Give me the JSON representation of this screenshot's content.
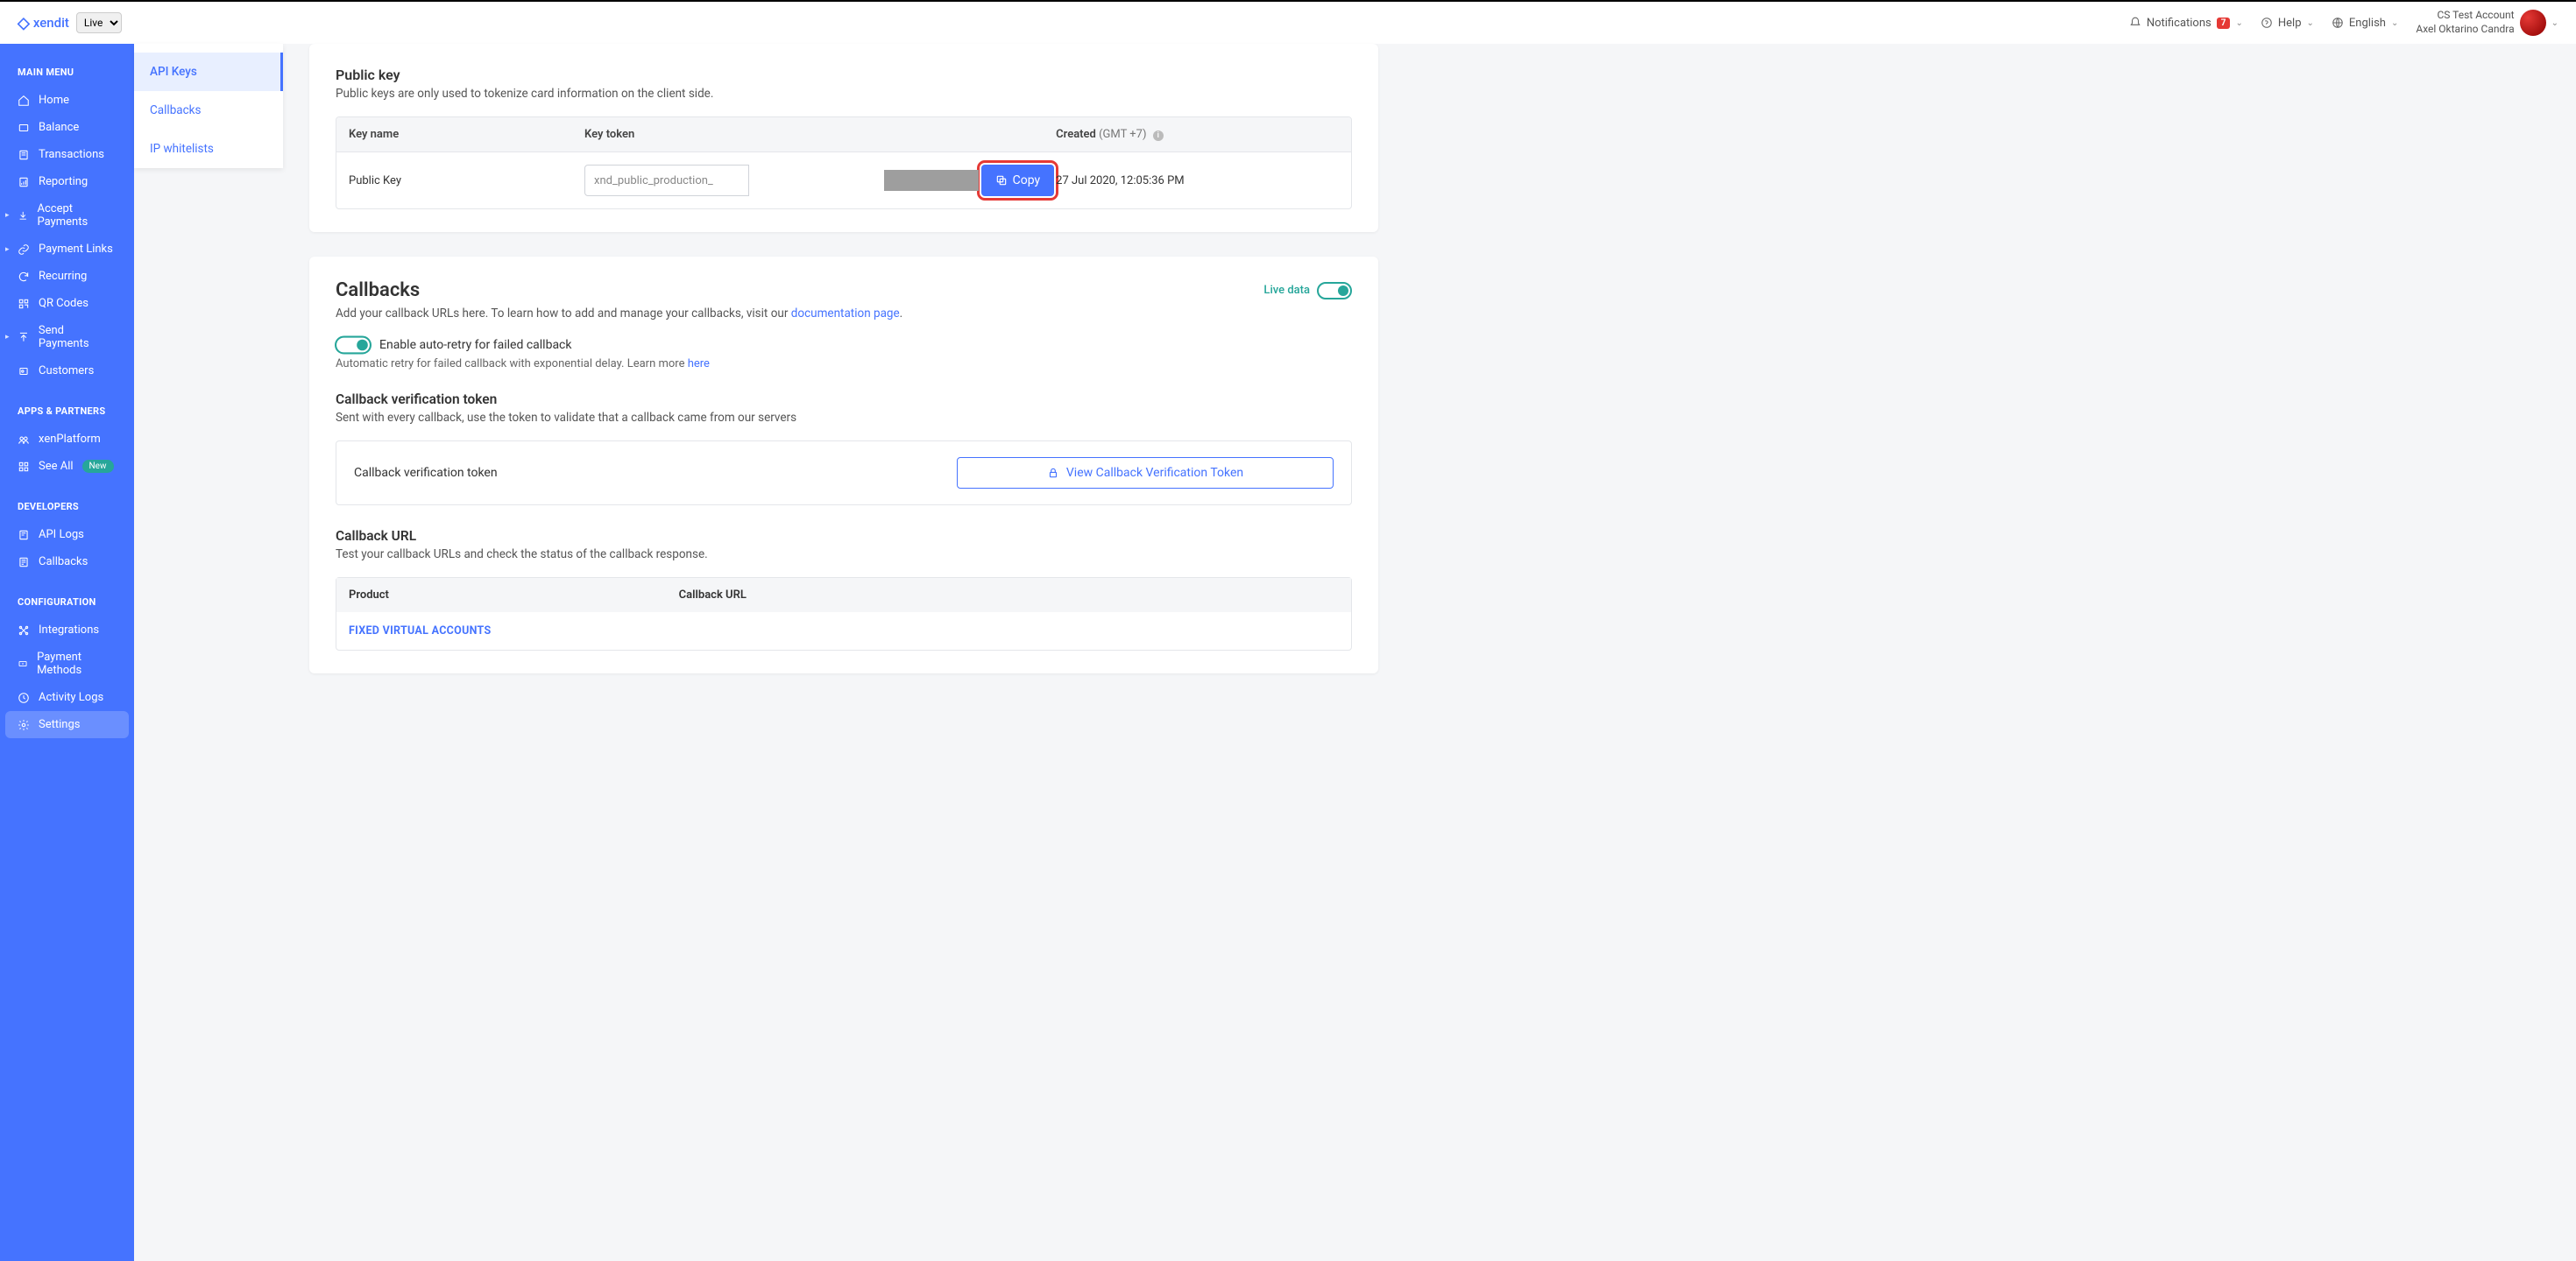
{
  "topbar": {
    "logo": "xendit",
    "env": "Live",
    "notifications_label": "Notifications",
    "notifications_count": "7",
    "help_label": "Help",
    "language_label": "English",
    "account_name": "CS Test Account",
    "user_name": "Axel Oktarino Candra"
  },
  "sidebar": {
    "section_main": "MAIN MENU",
    "items_main": [
      {
        "label": "Home"
      },
      {
        "label": "Balance"
      },
      {
        "label": "Transactions"
      },
      {
        "label": "Reporting"
      },
      {
        "label": "Accept Payments"
      },
      {
        "label": "Payment Links"
      },
      {
        "label": "Recurring"
      },
      {
        "label": "QR Codes"
      },
      {
        "label": "Send Payments"
      },
      {
        "label": "Customers"
      }
    ],
    "section_apps": "APPS & PARTNERS",
    "items_apps": [
      {
        "label": "xenPlatform"
      },
      {
        "label": "See All",
        "badge": "New"
      }
    ],
    "section_dev": "DEVELOPERS",
    "items_dev": [
      {
        "label": "API Logs"
      },
      {
        "label": "Callbacks"
      }
    ],
    "section_config": "CONFIGURATION",
    "items_config": [
      {
        "label": "Integrations"
      },
      {
        "label": "Payment Methods"
      },
      {
        "label": "Activity Logs"
      },
      {
        "label": "Settings"
      }
    ]
  },
  "subsidebar": {
    "items": [
      {
        "label": "API Keys"
      },
      {
        "label": "Callbacks"
      },
      {
        "label": "IP whitelists"
      }
    ]
  },
  "public_key": {
    "title": "Public key",
    "desc": "Public keys are only used to tokenize card information on the client side.",
    "col_name": "Key name",
    "col_token": "Key token",
    "col_created": "Created",
    "col_created_tz": "(GMT +7)",
    "row_name": "Public Key",
    "row_token": "xnd_public_production_",
    "copy_label": "Copy",
    "row_created": "27 Jul 2020, 12:05:36 PM"
  },
  "callbacks": {
    "title": "Callbacks",
    "live_data_label": "Live data",
    "intro_pre": "Add your callback URLs here. To learn how to add and manage your callbacks, visit our ",
    "intro_link": "documentation page",
    "intro_post": ".",
    "auto_retry_label": "Enable auto-retry for failed callback",
    "auto_retry_desc_pre": "Automatic retry for failed callback with exponential delay. Learn more ",
    "auto_retry_link": "here",
    "verif_title": "Callback verification token",
    "verif_desc": "Sent with every callback, use the token to validate that a callback came from our servers",
    "verif_row_label": "Callback verification token",
    "verif_button": "View Callback Verification Token",
    "url_title": "Callback URL",
    "url_desc": "Test your callback URLs and check the status of the callback response.",
    "url_col_product": "Product",
    "url_col_url": "Callback URL",
    "url_cat_fva": "FIXED VIRTUAL ACCOUNTS"
  }
}
